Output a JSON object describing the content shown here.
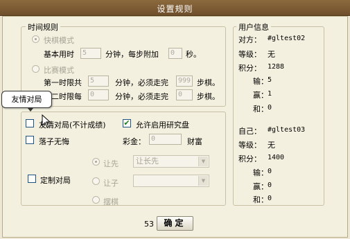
{
  "window": {
    "title": "设置规则"
  },
  "time_rules": {
    "legend": "时间规则",
    "fast_mode": {
      "label": "快棋模式",
      "base_label": "基本用时",
      "base_value": "5",
      "minutes_each_add": "分钟，每步附加",
      "add_value": "0",
      "seconds_unit": "秒。"
    },
    "match_mode": {
      "label": "比赛模式",
      "first_limit_label": "第一时限共",
      "first_minutes": "5",
      "minutes_must_go": "分钟，必须走完",
      "first_moves": "999",
      "moves_unit": "步棋。",
      "second_limit_label": "第二时限每",
      "second_minutes": "0",
      "second_moves": "0"
    }
  },
  "options": {
    "friendly_game": "友情对局(不计成绩)",
    "allow_study": "允许启用研究盘",
    "no_takeback": "落子无悔",
    "prize_label": "彩金：",
    "prize_value": "0",
    "prize_unit": "财富",
    "custom_game": "定制对局",
    "first_move_label": "让先",
    "first_move_select": "让长先",
    "handicap_label": "让子",
    "handicap_select": "",
    "arrange_label": "摆棋"
  },
  "user_info": {
    "legend": "用户信息",
    "opponent": {
      "name_label": "对方：",
      "name": "#gltest02",
      "level_label": "等级：",
      "level": "无",
      "points_label": "积分：",
      "points": "1288",
      "lose_label": "输：",
      "lose": "5",
      "win_label": "赢：",
      "win": "1",
      "draw_label": "和：",
      "draw": "0"
    },
    "self": {
      "name_label": "自己：",
      "name": "#gltest03",
      "level_label": "等级：",
      "level": "无",
      "points_label": "积分：",
      "points": "1400",
      "lose_label": "输：",
      "lose": "0",
      "win_label": "赢：",
      "win": "0",
      "draw_label": "和：",
      "draw": "0"
    }
  },
  "tooltip": {
    "text": "友情对局"
  },
  "footer": {
    "countdown": "53",
    "ok_label": "确定"
  },
  "colors": {
    "titlebar": "#7a5a34",
    "panel": "#f3f0df",
    "disabled_text": "#a8a496"
  },
  "checkbox_states": {
    "friendly_game": false,
    "allow_study": true,
    "no_takeback": false,
    "custom_game": false
  },
  "radio_states": {
    "fast_mode": true,
    "match_mode": false,
    "first_move": true,
    "handicap": false,
    "arrange": false
  }
}
